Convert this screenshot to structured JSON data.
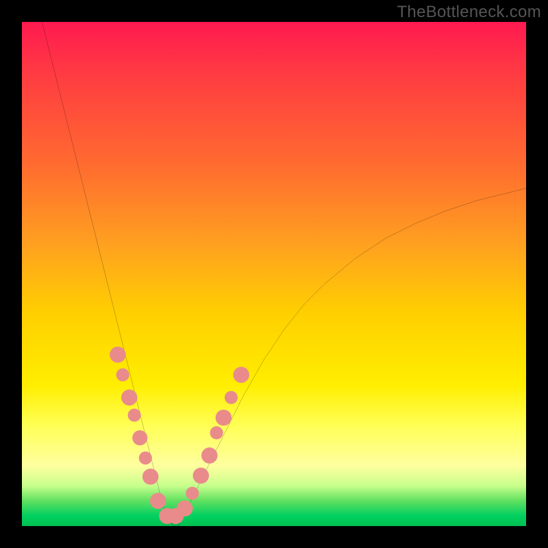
{
  "watermark": "TheBottleneck.com",
  "chart_data": {
    "type": "line",
    "title": "",
    "xlabel": "",
    "ylabel": "",
    "xlim": [
      0,
      100
    ],
    "ylim": [
      0,
      100
    ],
    "series": [
      {
        "name": "curve",
        "x": [
          4,
          6,
          8,
          10,
          12,
          14,
          16,
          18,
          20,
          22,
          23,
          24,
          25,
          26,
          27,
          28,
          29,
          30,
          31,
          32,
          34,
          36,
          38,
          40,
          44,
          48,
          52,
          56,
          60,
          66,
          72,
          78,
          84,
          90,
          96,
          100
        ],
        "values": [
          100,
          92,
          84,
          76,
          68,
          60,
          52,
          44,
          36,
          28,
          24,
          20,
          16,
          12,
          8,
          4,
          2,
          0,
          0,
          2,
          6,
          10,
          14,
          18,
          26,
          33,
          39,
          44,
          48,
          53,
          57,
          60,
          62.5,
          64.5,
          66,
          67
        ]
      }
    ],
    "markers": [
      {
        "x": 19.0,
        "y": 34.0,
        "r": 1.6
      },
      {
        "x": 20.0,
        "y": 30.0,
        "r": 1.3
      },
      {
        "x": 21.3,
        "y": 25.5,
        "r": 1.6
      },
      {
        "x": 22.3,
        "y": 22.0,
        "r": 1.3
      },
      {
        "x": 23.4,
        "y": 17.5,
        "r": 1.5
      },
      {
        "x": 24.5,
        "y": 13.5,
        "r": 1.3
      },
      {
        "x": 25.5,
        "y": 9.8,
        "r": 1.6
      },
      {
        "x": 27.0,
        "y": 5.0,
        "r": 1.6
      },
      {
        "x": 28.8,
        "y": 2.0,
        "r": 1.6
      },
      {
        "x": 30.5,
        "y": 2.0,
        "r": 1.6
      },
      {
        "x": 32.3,
        "y": 3.5,
        "r": 1.6
      },
      {
        "x": 33.8,
        "y": 6.5,
        "r": 1.3
      },
      {
        "x": 35.5,
        "y": 10.0,
        "r": 1.6
      },
      {
        "x": 37.2,
        "y": 14.0,
        "r": 1.6
      },
      {
        "x": 38.6,
        "y": 18.5,
        "r": 1.3
      },
      {
        "x": 40.0,
        "y": 21.5,
        "r": 1.6
      },
      {
        "x": 41.5,
        "y": 25.5,
        "r": 1.3
      },
      {
        "x": 43.5,
        "y": 30.0,
        "r": 1.6
      }
    ],
    "marker_color": "#e98b8b"
  }
}
